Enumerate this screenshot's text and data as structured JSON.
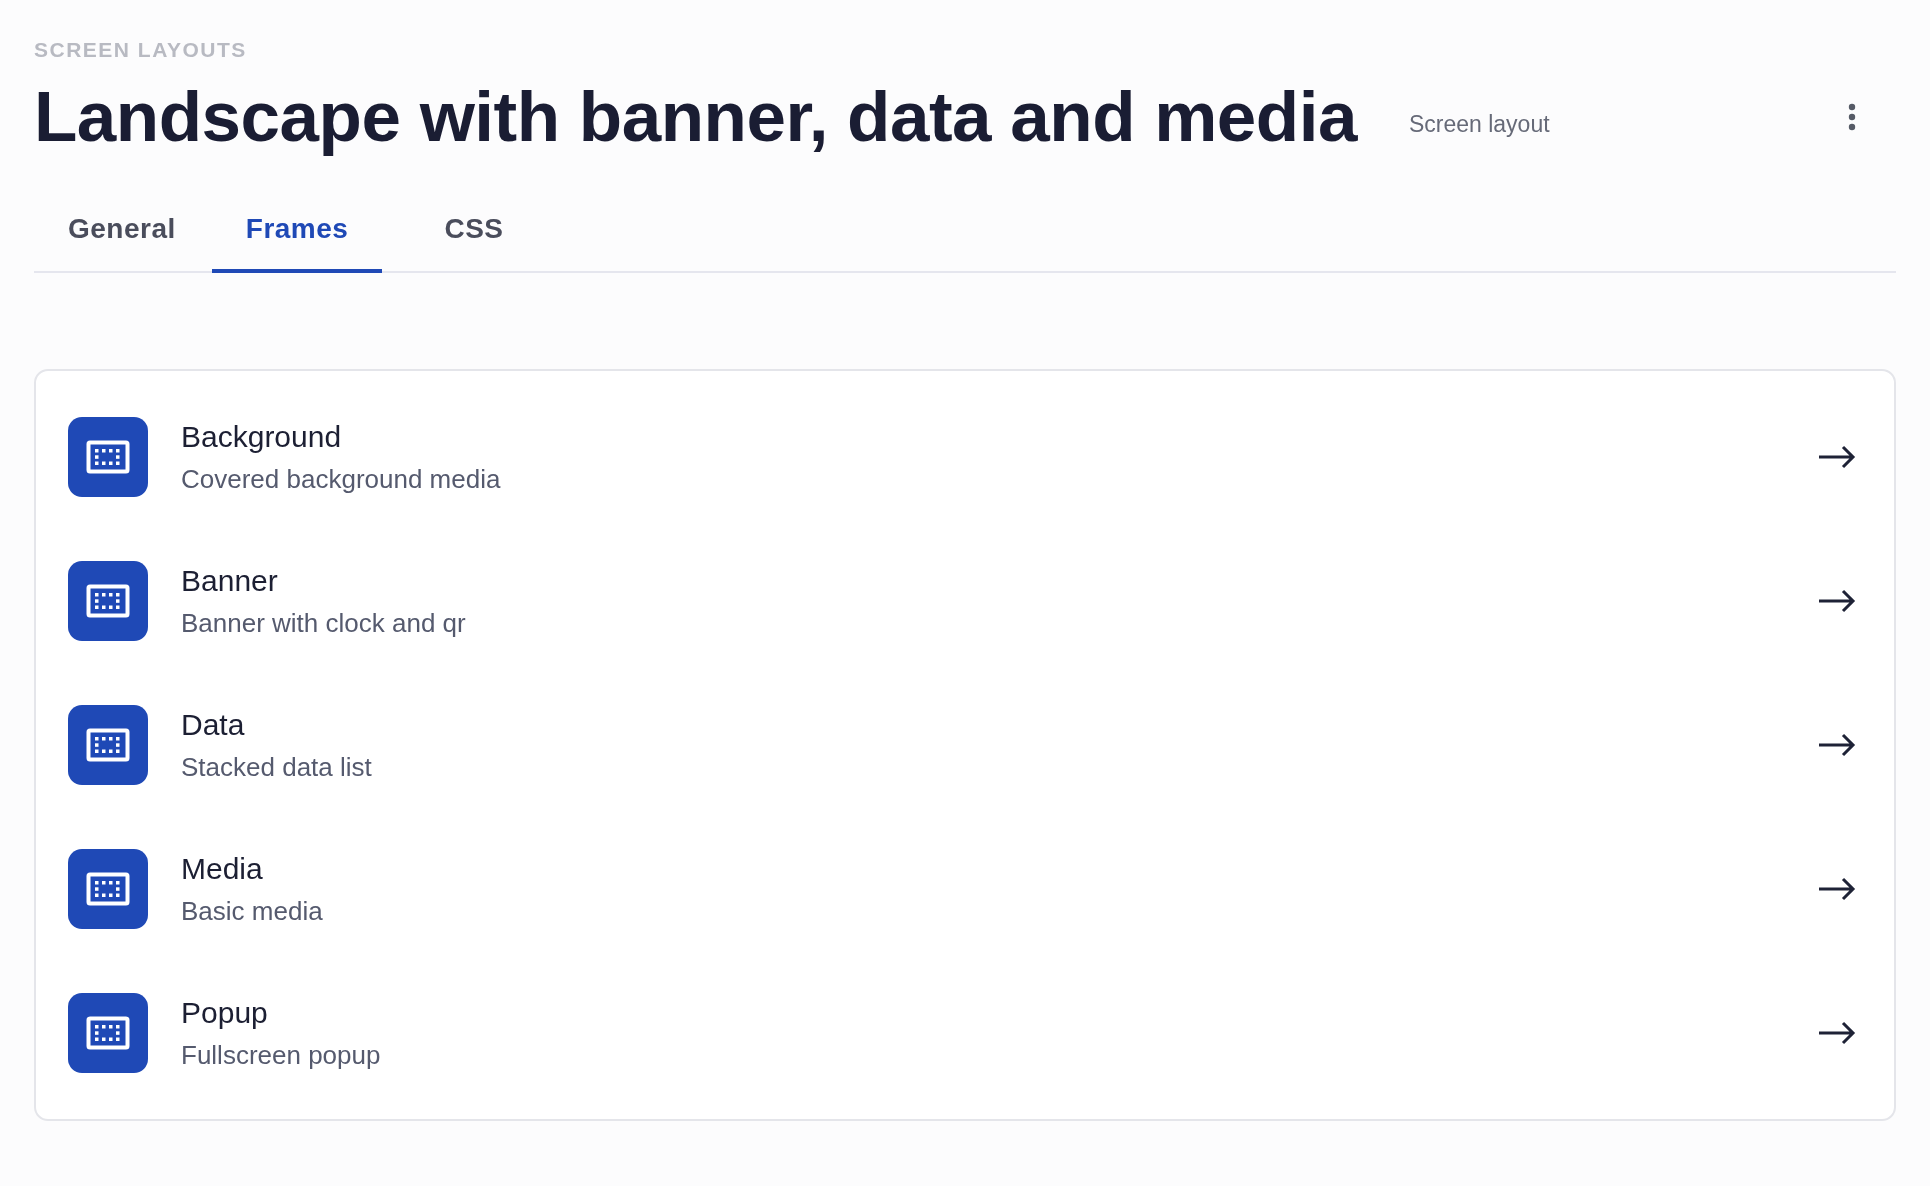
{
  "eyebrow": "SCREEN LAYOUTS",
  "title": "Landscape with banner, data and media",
  "subtitle": "Screen layout",
  "tabs": [
    {
      "label": "General",
      "selected": false
    },
    {
      "label": "Frames",
      "selected": true
    },
    {
      "label": "CSS",
      "selected": false
    }
  ],
  "frames": [
    {
      "name": "Background",
      "description": "Covered background media"
    },
    {
      "name": "Banner",
      "description": "Banner with clock and qr"
    },
    {
      "name": "Data",
      "description": "Stacked data list"
    },
    {
      "name": "Media",
      "description": "Basic media"
    },
    {
      "name": "Popup",
      "description": "Fullscreen popup"
    }
  ]
}
